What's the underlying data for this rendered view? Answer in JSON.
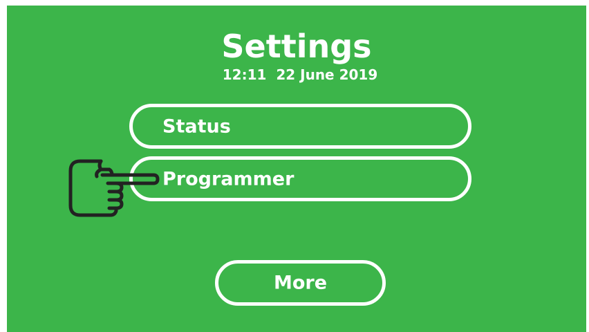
{
  "header": {
    "title": "Settings",
    "datetime": "12:11  22 June 2019"
  },
  "menu": {
    "status_label": "Status",
    "programmer_label": "Programmer",
    "more_label": "More"
  },
  "pointer": {
    "icon": "pointing-hand-icon"
  },
  "colors": {
    "background": "#3cb54a",
    "foreground": "#ffffff",
    "pointer_stroke": "#222222"
  }
}
